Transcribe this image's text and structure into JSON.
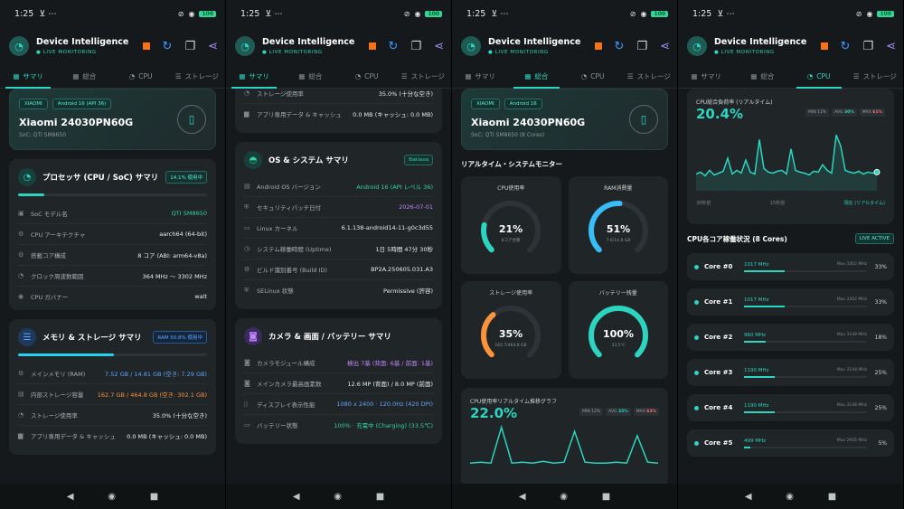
{
  "status": {
    "time": "1:25",
    "extra": "⊻ ⋯",
    "battery": "100"
  },
  "app": {
    "title": "Device Intelligence",
    "subtitle": "● LIVE MONITORING"
  },
  "tabs": [
    "サマリ",
    "総合",
    "CPU",
    "ストレージ"
  ],
  "device": {
    "brand": "XIAOMI",
    "os_chip": "Android 16 (API 36)",
    "os_chip_short": "Android 16",
    "name": "Xiaomi 24030PN60G",
    "soc": "SoC: QTI SM8650",
    "soc_cores": "SoC: QTI SM8650 (8 Cores)"
  },
  "processor": {
    "title": "プロセッサ (CPU / SoC) サマリ",
    "badge": "14.1% 使用中",
    "usage": 14.1,
    "rows": [
      {
        "label": "SoC モデル名",
        "value": "QTI SM8650"
      },
      {
        "label": "CPU アーキテクチャ",
        "value": "aarch64 (64-bit)"
      },
      {
        "label": "搭載コア構成",
        "value": "8 コア (ABI: arm64-v8a)"
      },
      {
        "label": "クロック周波数範囲",
        "value": "364 MHz 〜 3302 MHz"
      },
      {
        "label": "CPU ガバナー",
        "value": "walt"
      }
    ]
  },
  "memory": {
    "title": "メモリ & ストレージ サマリ",
    "badge": "RAM 50.8% 使用中",
    "usage": 50.8,
    "rows": [
      {
        "label": "メインメモリ (RAM)",
        "value": "7.52 GB / 14.81 GB (空き: 7.29 GB)"
      },
      {
        "label": "内部ストレージ容量",
        "value": "162.7 GB / 464.8 GB (空き: 302.1 GB)"
      },
      {
        "label": "ストレージ使用率",
        "value": "35.0% (十分な空き)"
      },
      {
        "label": "アプリ専用データ & キャッシュ",
        "value": "0.0 MB (キャッシュ: 0.0 MB)"
      }
    ]
  },
  "storage_top": [
    {
      "label": "ストレージ使用率",
      "value": "35.0% (十分な空き)"
    },
    {
      "label": "アプリ専用データ & キャッシュ",
      "value": "0.0 MB (キャッシュ: 0.0 MB)"
    }
  ],
  "os": {
    "title": "OS & システム サマリ",
    "badge": "Baklava",
    "rows": [
      {
        "label": "Android OS バージョン",
        "value": "Android 16 (API レベル 36)"
      },
      {
        "label": "セキュリティパッチ日付",
        "value": "2026-07-01"
      },
      {
        "label": "Linux カーネル",
        "value": "6.1.138-android14-11-g0c3d55"
      },
      {
        "label": "システム稼働時間 (Uptime)",
        "value": "1日 5時間 47分 30秒"
      },
      {
        "label": "ビルド識別番号 (Build ID)",
        "value": "BP2A.250605.031.A3"
      },
      {
        "label": "SELinux 状態",
        "value": "Permissive (許容)"
      }
    ]
  },
  "camera": {
    "title": "カメラ & 画面 / バッテリー サマリ",
    "rows": [
      {
        "label": "カメラモジュール構成",
        "value": "検出 7基 (背面: 6基 / 前面: 1基)"
      },
      {
        "label": "メインカメラ最高画素数",
        "value": "12.6 MP (背面) / 8.0 MP (前面)"
      },
      {
        "label": "ディスプレイ表示性能",
        "value": "1080 x 2400 · 120.0Hz (420 DPI)"
      },
      {
        "label": "バッテリー状態",
        "value": "100% · 充電中 (Charging) (33.5℃)"
      }
    ]
  },
  "monitor": {
    "title": "リアルタイム・システムモニター",
    "gauges": [
      {
        "label": "CPU使用率",
        "value": "21%",
        "sub": "8コア合算",
        "pct": 0.21,
        "color": "#2dd4bf"
      },
      {
        "label": "RAM消費量",
        "value": "51%",
        "sub": "7.6/14.8 GB",
        "pct": 0.51,
        "color": "#38bdf8"
      },
      {
        "label": "ストレージ使用率",
        "value": "35%",
        "sub": "162.7/464.8 GB",
        "pct": 0.35,
        "color": "#fb923c"
      },
      {
        "label": "バッテリー残量",
        "value": "100%",
        "sub": "33.5℃",
        "pct": 1.0,
        "color": "#2dd4bf"
      }
    ],
    "graph_title": "CPU使用率リアルタイム推移グラフ",
    "graph_value": "22.0%",
    "min": "MIN 12%",
    "avg_label": "AVG",
    "avg": "35%",
    "max_label": "MAX",
    "max": "63%"
  },
  "cpu": {
    "title": "CPU総合負荷率 (リアルタイム)",
    "value": "20.4%",
    "min": "MIN 12%",
    "avg_label": "AVG",
    "avg": "30%",
    "max_label": "MAX",
    "max": "61%",
    "x_labels": [
      "30秒前",
      "15秒前",
      "現在 (リアルタイム)"
    ],
    "series": [
      18,
      20,
      16,
      22,
      17,
      19,
      21,
      35,
      18,
      22,
      19,
      33,
      20,
      18,
      55,
      24,
      20,
      19,
      21,
      22,
      18,
      45,
      22,
      20,
      19,
      17,
      21,
      20,
      28,
      22,
      19,
      60,
      48,
      22,
      20,
      19,
      21,
      18,
      20,
      19,
      20
    ],
    "cores_title": "CPU各コア稼働状況 (8 Cores)",
    "live": "LIVE ACTIVE",
    "cores": [
      {
        "name": "Core #0",
        "freq": "1017 MHz",
        "max": "Max 3302 MHz",
        "pct": "33%",
        "fill": 0.33
      },
      {
        "name": "Core #1",
        "freq": "1017 MHz",
        "max": "Max 3302 MHz",
        "pct": "33%",
        "fill": 0.33
      },
      {
        "name": "Core #2",
        "freq": "960 MHz",
        "max": "Max 3148 MHz",
        "pct": "18%",
        "fill": 0.18
      },
      {
        "name": "Core #3",
        "freq": "1190 MHz",
        "max": "Max 3148 MHz",
        "pct": "25%",
        "fill": 0.25
      },
      {
        "name": "Core #4",
        "freq": "1190 MHz",
        "max": "Max 3148 MHz",
        "pct": "25%",
        "fill": 0.25
      },
      {
        "name": "Core #5",
        "freq": "499 MHz",
        "max": "Max 2956 MHz",
        "pct": "5%",
        "fill": 0.05
      }
    ]
  }
}
